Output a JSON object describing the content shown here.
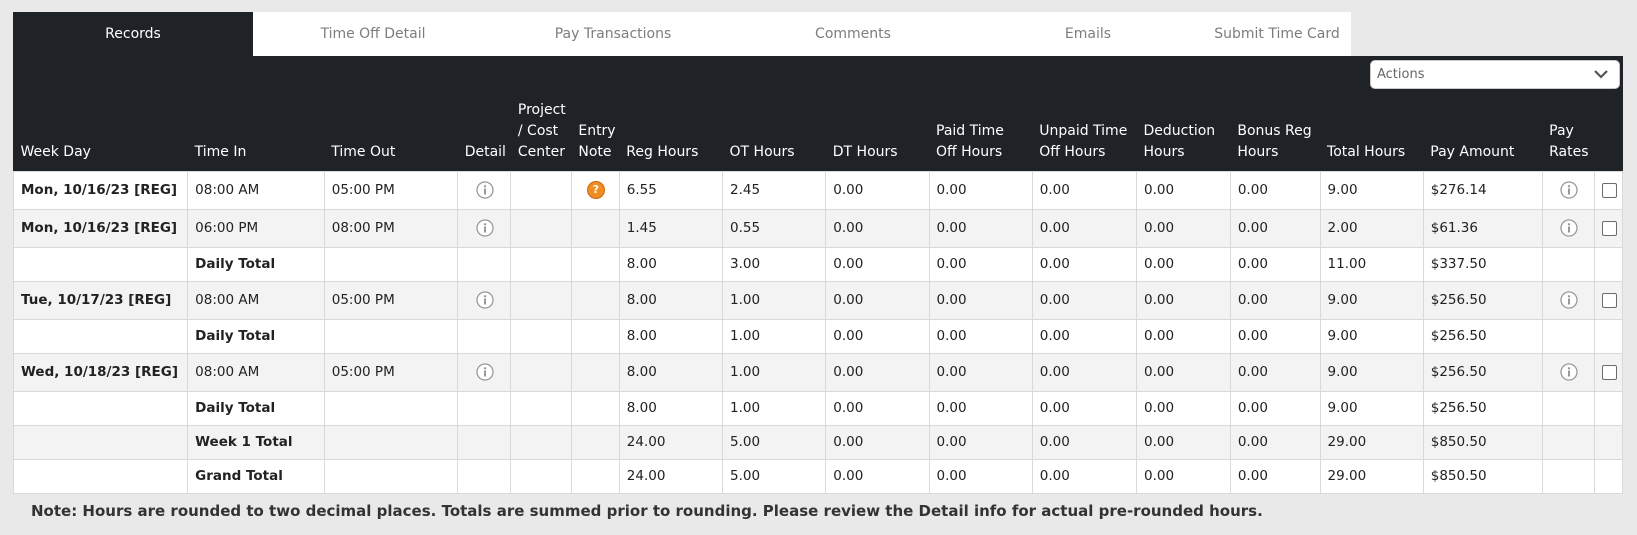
{
  "tabs": [
    {
      "label": "Records",
      "active": true
    },
    {
      "label": "Time Off Detail",
      "active": false
    },
    {
      "label": "Pay Transactions",
      "active": false
    },
    {
      "label": "Comments",
      "active": false
    },
    {
      "label": "Emails",
      "active": false
    },
    {
      "label": "Submit Time Card",
      "active": false
    }
  ],
  "actions": {
    "placeholder": "Actions"
  },
  "columns": [
    "Week Day",
    "Time In",
    "Time Out",
    "Detail",
    "Project / Cost Center",
    "Entry Note",
    "Reg Hours",
    "OT Hours",
    "DT Hours",
    "Paid Time Off Hours",
    "Unpaid Time Off Hours",
    "Deduction Hours",
    "Bonus Reg Hours",
    "Total Hours",
    "Pay Amount",
    "Pay Rates"
  ],
  "rows": [
    {
      "weekday": "Mon, 10/16/23 [REG]",
      "time_in": "08:00 AM",
      "time_out": "05:00 PM",
      "reg": "6.55",
      "ot": "2.45",
      "dt": "0.00",
      "pto": "0.00",
      "upto": "0.00",
      "ded": "0.00",
      "bonus": "0.00",
      "total": "9.00",
      "pay": "$276.14"
    },
    {
      "weekday": "Mon, 10/16/23 [REG]",
      "time_in": "06:00 PM",
      "time_out": "08:00 PM",
      "reg": "1.45",
      "ot": "0.55",
      "dt": "0.00",
      "pto": "0.00",
      "upto": "0.00",
      "ded": "0.00",
      "bonus": "0.00",
      "total": "2.00",
      "pay": "$61.36"
    },
    {
      "label": "Daily Total",
      "reg": "8.00",
      "ot": "3.00",
      "dt": "0.00",
      "pto": "0.00",
      "upto": "0.00",
      "ded": "0.00",
      "bonus": "0.00",
      "total": "11.00",
      "pay": "$337.50"
    },
    {
      "weekday": "Tue, 10/17/23 [REG]",
      "time_in": "08:00 AM",
      "time_out": "05:00 PM",
      "reg": "8.00",
      "ot": "1.00",
      "dt": "0.00",
      "pto": "0.00",
      "upto": "0.00",
      "ded": "0.00",
      "bonus": "0.00",
      "total": "9.00",
      "pay": "$256.50"
    },
    {
      "label": "Daily Total",
      "reg": "8.00",
      "ot": "1.00",
      "dt": "0.00",
      "pto": "0.00",
      "upto": "0.00",
      "ded": "0.00",
      "bonus": "0.00",
      "total": "9.00",
      "pay": "$256.50"
    },
    {
      "weekday": "Wed, 10/18/23 [REG]",
      "time_in": "08:00 AM",
      "time_out": "05:00 PM",
      "reg": "8.00",
      "ot": "1.00",
      "dt": "0.00",
      "pto": "0.00",
      "upto": "0.00",
      "ded": "0.00",
      "bonus": "0.00",
      "total": "9.00",
      "pay": "$256.50"
    },
    {
      "label": "Daily Total",
      "reg": "8.00",
      "ot": "1.00",
      "dt": "0.00",
      "pto": "0.00",
      "upto": "0.00",
      "ded": "0.00",
      "bonus": "0.00",
      "total": "9.00",
      "pay": "$256.50"
    },
    {
      "label": "Week 1 Total",
      "reg": "24.00",
      "ot": "5.00",
      "dt": "0.00",
      "pto": "0.00",
      "upto": "0.00",
      "ded": "0.00",
      "bonus": "0.00",
      "total": "29.00",
      "pay": "$850.50"
    },
    {
      "label": "Grand Total",
      "reg": "24.00",
      "ot": "5.00",
      "dt": "0.00",
      "pto": "0.00",
      "upto": "0.00",
      "ded": "0.00",
      "bonus": "0.00",
      "total": "29.00",
      "pay": "$850.50"
    }
  ],
  "entry_note_icon": "question-icon",
  "detail_icon": "info-icon",
  "note": "Note: Hours are rounded to two decimal places. Totals are summed prior to rounding. Please review the Detail info for actual pre-rounded hours.",
  "colors": {
    "header_bg": "#1f2227",
    "link": "#2b6fd6",
    "note_icon": "#f08c24"
  }
}
